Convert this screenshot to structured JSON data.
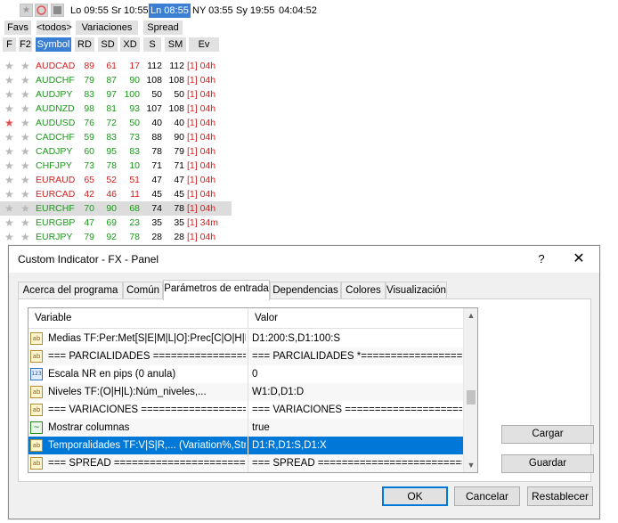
{
  "panel": {
    "sessions": [
      {
        "label": "Lo 09:55",
        "active": false
      },
      {
        "label": "Sr 10:55",
        "active": false
      },
      {
        "label": "Ln 08:55",
        "active": true
      },
      {
        "label": "NY 03:55",
        "active": false
      },
      {
        "label": "Sy 19:55",
        "active": false
      },
      {
        "label": "04:04:52",
        "active": false
      }
    ],
    "nav_buttons": [
      "Favs",
      "<todos>",
      "Variaciones",
      "Spread"
    ],
    "columns": [
      "F",
      "F2",
      "Symbol",
      "RD",
      "SD",
      "XD",
      "S",
      "SM",
      "Ev"
    ],
    "rows": [
      {
        "f_star_red": false,
        "symbol": "AUDCAD",
        "dir": "neg",
        "rd": "89",
        "sd": "61",
        "xd": "17",
        "s": "112",
        "sm": "112",
        "ev": "[1] 04h",
        "highlight": false
      },
      {
        "f_star_red": false,
        "symbol": "AUDCHF",
        "dir": "pos",
        "rd": "79",
        "sd": "87",
        "xd": "90",
        "s": "108",
        "sm": "108",
        "ev": "[1] 04h",
        "highlight": false
      },
      {
        "f_star_red": false,
        "symbol": "AUDJPY",
        "dir": "pos",
        "rd": "83",
        "sd": "97",
        "xd": "100",
        "s": "50",
        "sm": "50",
        "ev": "[1] 04h",
        "highlight": false
      },
      {
        "f_star_red": false,
        "symbol": "AUDNZD",
        "dir": "pos",
        "rd": "98",
        "sd": "81",
        "xd": "93",
        "s": "107",
        "sm": "108",
        "ev": "[1] 04h",
        "highlight": false
      },
      {
        "f_star_red": true,
        "symbol": "AUDUSD",
        "dir": "pos",
        "rd": "76",
        "sd": "72",
        "xd": "50",
        "s": "40",
        "sm": "40",
        "ev": "[1] 04h",
        "highlight": false
      },
      {
        "f_star_red": false,
        "symbol": "CADCHF",
        "dir": "pos",
        "rd": "59",
        "sd": "83",
        "xd": "73",
        "s": "88",
        "sm": "90",
        "ev": "[1] 04h",
        "highlight": false
      },
      {
        "f_star_red": false,
        "symbol": "CADJPY",
        "dir": "pos",
        "rd": "60",
        "sd": "95",
        "xd": "83",
        "s": "78",
        "sm": "79",
        "ev": "[1] 04h",
        "highlight": false
      },
      {
        "f_star_red": false,
        "symbol": "CHFJPY",
        "dir": "pos",
        "rd": "73",
        "sd": "78",
        "xd": "10",
        "s": "71",
        "sm": "71",
        "ev": "[1] 04h",
        "highlight": false
      },
      {
        "f_star_red": false,
        "symbol": "EURAUD",
        "dir": "neg",
        "rd": "65",
        "sd": "52",
        "xd": "51",
        "s": "47",
        "sm": "47",
        "ev": "[1] 04h",
        "highlight": false
      },
      {
        "f_star_red": false,
        "symbol": "EURCAD",
        "dir": "neg",
        "rd": "42",
        "sd": "46",
        "xd": "11",
        "s": "45",
        "sm": "45",
        "ev": "[1] 04h",
        "highlight": false
      },
      {
        "f_star_red": false,
        "symbol": "EURCHF",
        "dir": "pos",
        "rd": "70",
        "sd": "90",
        "xd": "68",
        "s": "74",
        "sm": "78",
        "ev": "[1] 04h",
        "highlight": true
      },
      {
        "f_star_red": false,
        "symbol": "EURGBP",
        "dir": "pos",
        "rd": "47",
        "sd": "69",
        "xd": "23",
        "s": "35",
        "sm": "35",
        "ev": "[1] 34m",
        "highlight": false
      },
      {
        "f_star_red": false,
        "symbol": "EURJPY",
        "dir": "pos",
        "rd": "79",
        "sd": "92",
        "xd": "78",
        "s": "28",
        "sm": "28",
        "ev": "[1] 04h",
        "highlight": false
      }
    ]
  },
  "dialog": {
    "title": "Custom Indicator - FX - Panel",
    "help_label": "?",
    "close_label": "✕",
    "tabs": [
      {
        "label": "Acerca del programa",
        "active": false
      },
      {
        "label": "Común",
        "active": false
      },
      {
        "label": "Parámetros de entrada",
        "active": true
      },
      {
        "label": "Dependencias",
        "active": false
      },
      {
        "label": "Colores",
        "active": false
      },
      {
        "label": "Visualización",
        "active": false
      }
    ],
    "grid": {
      "header_variable": "Variable",
      "header_value": "Valor",
      "rows": [
        {
          "icon": "ab-icon",
          "variable": "Medias TF:Per:Met[S|E|M|L|O]:Prec[C|O|H|L|...",
          "value": "D1:200:S,D1:100:S",
          "selected": false
        },
        {
          "icon": "ab-icon",
          "variable": "=== PARCIALIDADES ===================",
          "value": "=== PARCIALIDADES *===================",
          "selected": false
        },
        {
          "icon": "number-icon",
          "variable": "Escala NR en pips (0 anula)",
          "value": "0",
          "selected": false
        },
        {
          "icon": "ab-icon",
          "variable": "Niveles TF:(O|H|L):Núm_niveles,...",
          "value": "W1:D,D1:D",
          "selected": false
        },
        {
          "icon": "ab-icon",
          "variable": "=== VARIACIONES ======================",
          "value": "=== VARIACIONES ======================",
          "selected": false
        },
        {
          "icon": "graph-icon",
          "variable": "Mostrar columnas",
          "value": "true",
          "selected": false
        },
        {
          "icon": "ab-icon",
          "variable": "Temporalidades TF:V|S|R,... (Variation%,Stre...",
          "value": "D1:R,D1:S,D1:X",
          "selected": true
        },
        {
          "icon": "ab-icon",
          "variable": "=== SPREAD ========================...",
          "value": "=== SPREAD ===========================",
          "selected": false
        }
      ]
    },
    "side_buttons": {
      "load": "Cargar",
      "save": "Guardar"
    },
    "buttons": {
      "ok": "OK",
      "cancel": "Cancelar",
      "reset": "Restablecer"
    }
  }
}
